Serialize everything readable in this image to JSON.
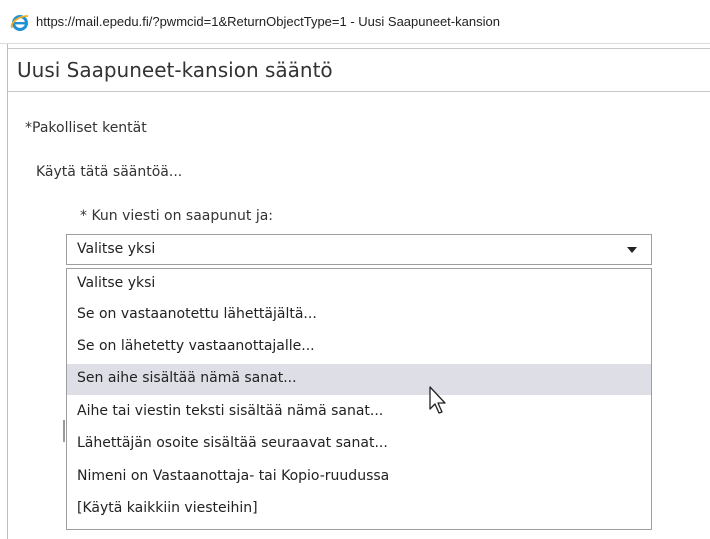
{
  "window": {
    "url_title": "https://mail.epedu.fi/?pwmcid=1&ReturnObjectType=1 - Uusi Saapuneet-kansion"
  },
  "page": {
    "title": "Uusi Saapuneet-kansion sääntö",
    "required_note": "*Pakolliset kentät",
    "apply_label": "Käytä tätä sääntöä...",
    "condition_label": "* Kun viesti on saapunut ja:"
  },
  "condition_select": {
    "selected": "Valitse yksi",
    "options": [
      "Valitse yksi",
      "Se on vastaanotettu lähettäjältä...",
      "Se on lähetetty vastaanottajalle...",
      "Sen aihe sisältää nämä sanat...",
      "Aihe tai viestin teksti sisältää nämä sanat...",
      "Lähettäjän osoite sisältää seuraavat sanat...",
      "Nimeni on Vastaanottaja- tai Kopio-ruudussa",
      "[Käytä kaikkiin viesteihin]"
    ],
    "hovered_option": "Sen aihe sisältää nämä sanat..."
  },
  "colors": {
    "hover_background": "#dedee6",
    "border": "#9e9e9e",
    "ie_blue": "#1e90d8"
  },
  "icons": {
    "browser": "internet-explorer-icon",
    "caret": "dropdown-caret-icon",
    "cursor": "mouse-pointer-icon"
  }
}
